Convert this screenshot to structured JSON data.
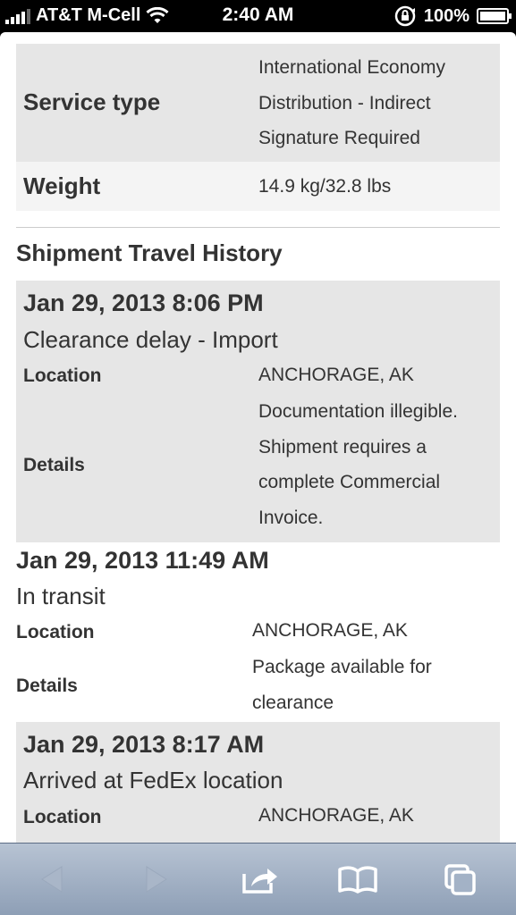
{
  "status_bar": {
    "carrier": "AT&T M-Cell",
    "time": "2:40 AM",
    "battery": "100%"
  },
  "shipment_info": {
    "service_type_label": "Service type",
    "service_type_line1": "International Economy",
    "service_type_line2": "Distribution - Indirect",
    "service_type_line3": "Signature Required",
    "weight_label": "Weight",
    "weight_value": "14.9 kg/32.8 lbs"
  },
  "history": {
    "title": "Shipment Travel History",
    "events": [
      {
        "date": "Jan 29, 2013 8:06 PM",
        "status": "Clearance delay - Import",
        "location_label": "Location",
        "location": "ANCHORAGE, AK",
        "details_label": "Details",
        "details_line1": "Documentation illegible.",
        "details_line2": "Shipment requires a",
        "details_line3": "complete Commercial",
        "details_line4": "Invoice."
      },
      {
        "date": "Jan 29, 2013 11:49 AM",
        "status": "In transit",
        "location_label": "Location",
        "location": "ANCHORAGE, AK",
        "details_label": "Details",
        "details_line1": "Package available for",
        "details_line2": "clearance"
      },
      {
        "date": "Jan 29, 2013 8:17 AM",
        "status": "Arrived at FedEx location",
        "location_label": "Location",
        "location": "ANCHORAGE, AK"
      }
    ]
  },
  "toolbar": {
    "icons": [
      "back-icon",
      "forward-icon",
      "share-icon",
      "bookmarks-icon",
      "tabs-icon"
    ]
  }
}
